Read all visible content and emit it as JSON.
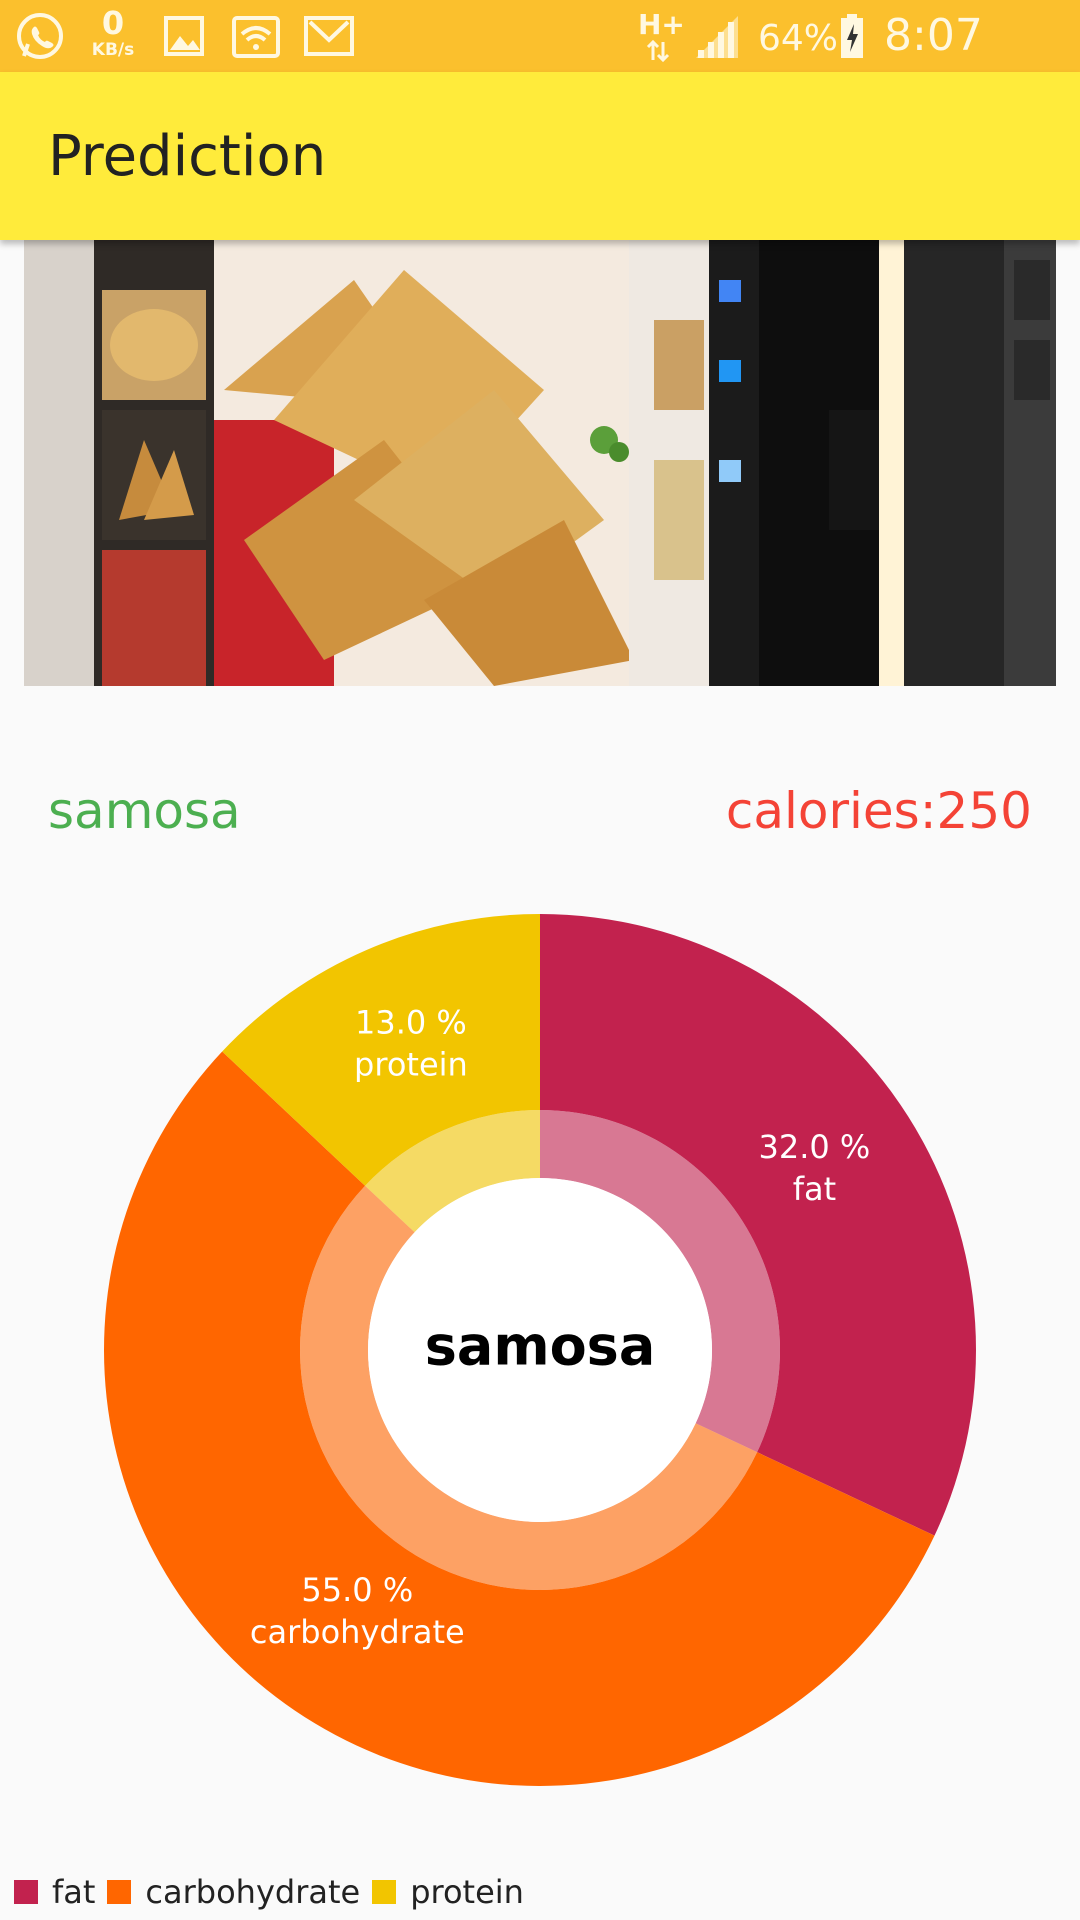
{
  "status_bar": {
    "network_speed_value": "0",
    "network_speed_unit": "KB/s",
    "network_type": "H+",
    "battery": "64%",
    "time": "8:07 a.m.",
    "icons": [
      "whatsapp-icon",
      "image-icon",
      "wifi-icon",
      "gmail-icon",
      "signal-icon",
      "battery-charging-icon"
    ]
  },
  "app_bar": {
    "title": "Prediction"
  },
  "prediction": {
    "food_name": "samosa",
    "calories_text": "calories:250"
  },
  "colors": {
    "status_bar": "#fbc02d",
    "app_bar": "#ffeb3b",
    "fat": "#c2224e",
    "carbohydrate": "#ff6600",
    "protein": "#f2c500",
    "food_name": "#4caf50",
    "calories": "#f44336"
  },
  "chart_data": {
    "type": "pie",
    "center_text": "samosa",
    "slices": [
      {
        "label": "fat",
        "value": 32.0,
        "value_text": "32.0 %",
        "color": "#c2224e"
      },
      {
        "label": "carbohydrate",
        "value": 55.0,
        "value_text": "55.0 %",
        "color": "#ff6600"
      },
      {
        "label": "protein",
        "value": 13.0,
        "value_text": "13.0 %",
        "color": "#f2c500"
      }
    ],
    "legend": [
      "fat",
      "carbohydrate",
      "protein"
    ],
    "legend_position": "bottom-left"
  }
}
